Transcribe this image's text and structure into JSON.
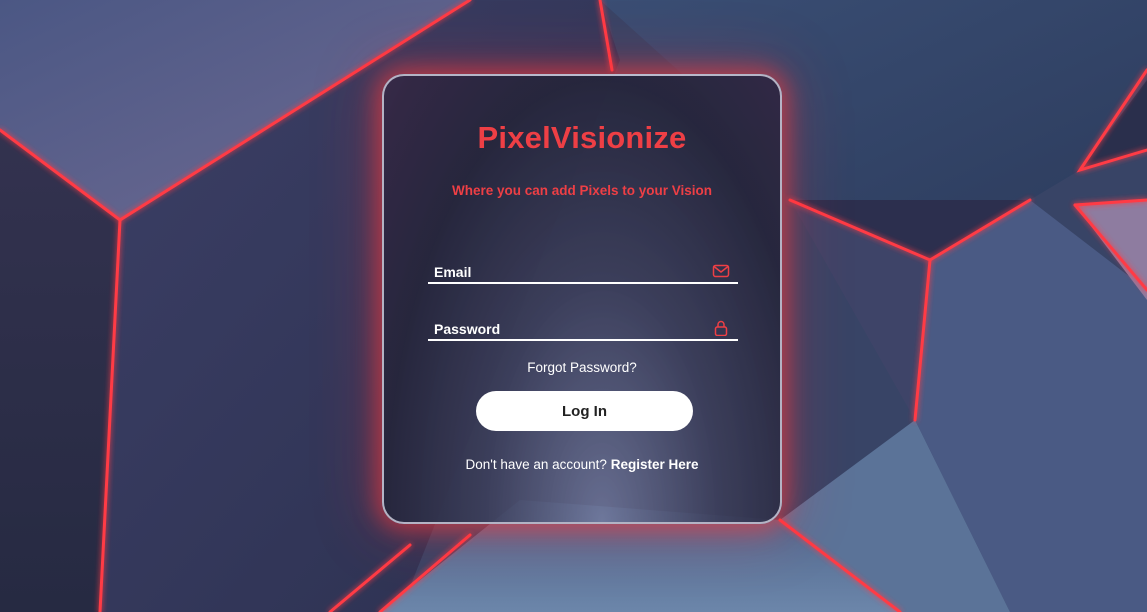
{
  "app": {
    "brand": "PixelVisionize",
    "tagline": "Where you can add Pixels to your Vision"
  },
  "form": {
    "email_label": "Email",
    "password_label": "Password",
    "forgot_label": "Forgot Password?",
    "login_label": "Log In",
    "register_prompt": "Don't have an account?",
    "register_link": "Register Here"
  },
  "icons": {
    "email": "mail-icon",
    "password": "lock-icon"
  },
  "colors": {
    "accent": "#ee3f45",
    "button_bg": "#ffffff",
    "text": "#ffffff"
  }
}
